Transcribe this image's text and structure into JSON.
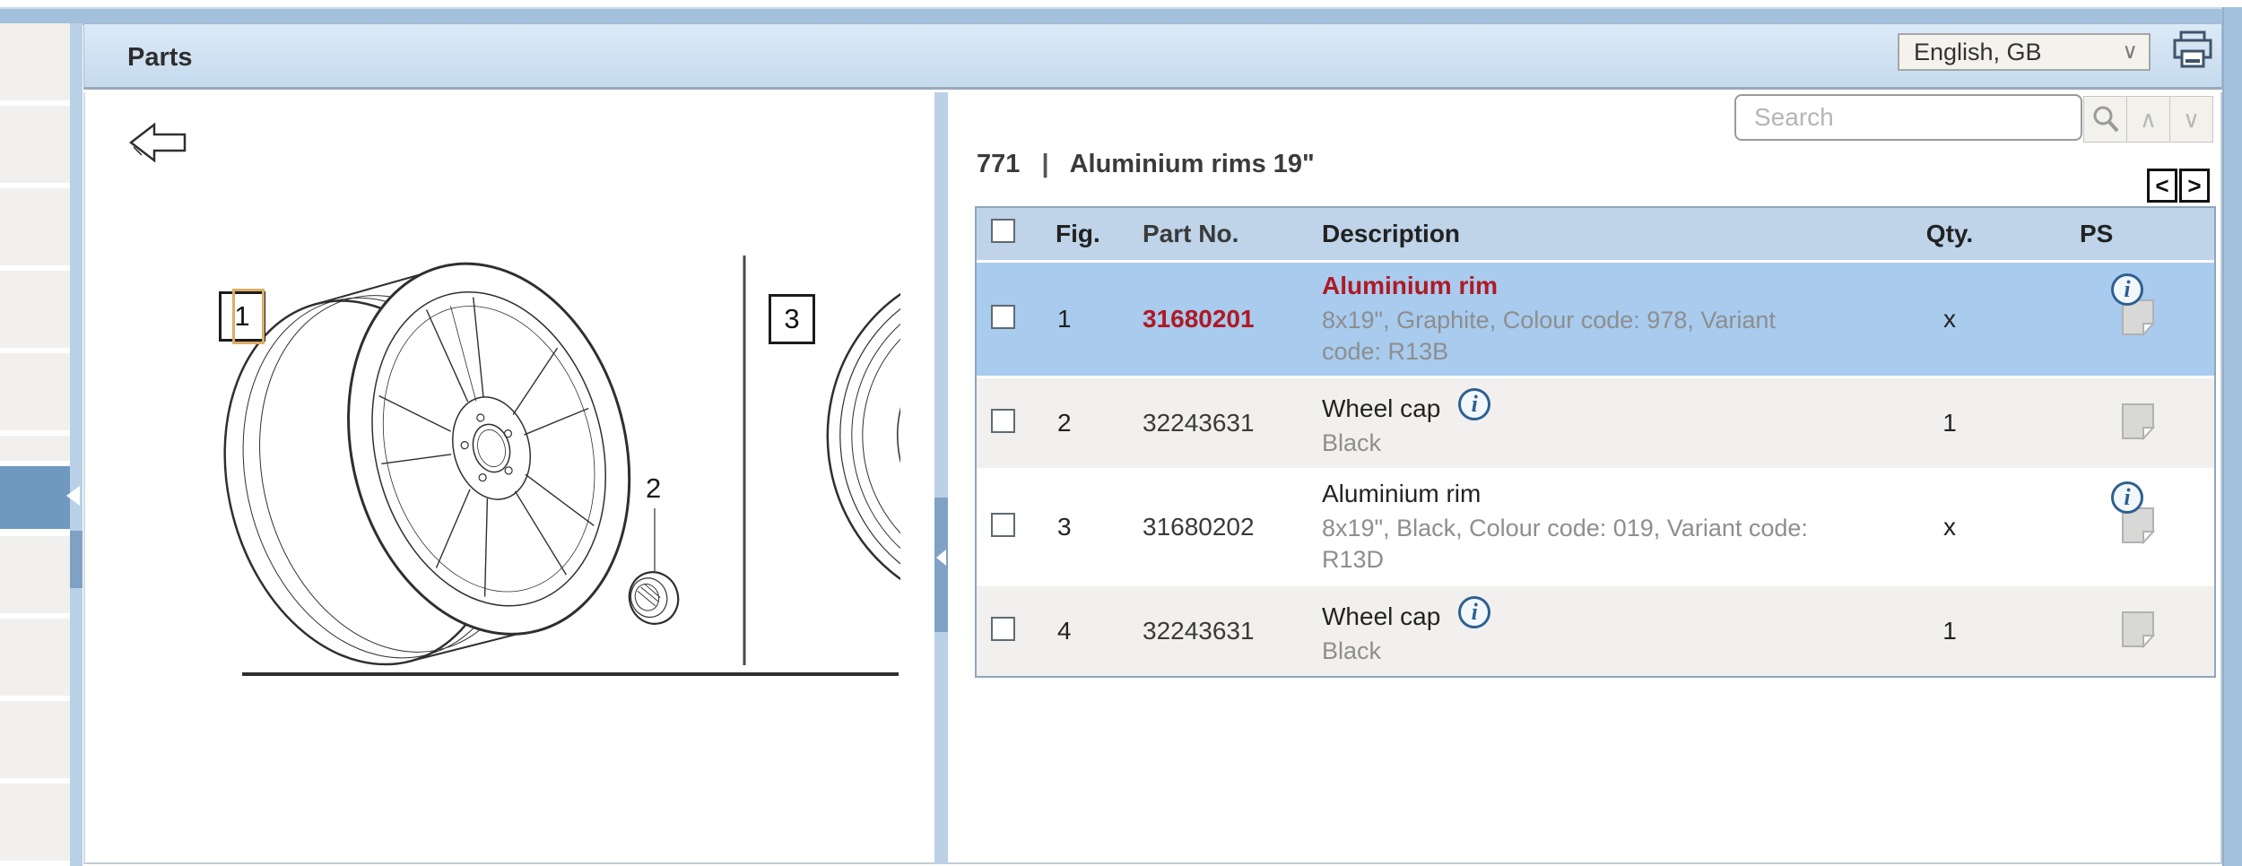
{
  "window": {
    "title": "Parts"
  },
  "toolbar": {
    "language_selector": {
      "value": "English, GB",
      "chevron": "∨"
    },
    "print_icon": "printer-icon"
  },
  "search": {
    "placeholder": "Search",
    "up_glyph": "∧",
    "down_glyph": "∨"
  },
  "section": {
    "number": "771",
    "divider": "|",
    "title": "Aluminium rims 19\""
  },
  "pager": {
    "prev": "<",
    "next": ">"
  },
  "diagram": {
    "callout_1": "1",
    "callout_2": "2",
    "callout_3": "3"
  },
  "table": {
    "headers": {
      "fig": "Fig.",
      "part_no": "Part No.",
      "description": "Description",
      "qty": "Qty.",
      "ps": "PS"
    },
    "rows": [
      {
        "fig": "1",
        "part_no": "31680201",
        "name": "Aluminium rim",
        "detail": "8x19\", Graphite, Colour code: 978, Variant code: R13B",
        "qty": "x",
        "selected": true
      },
      {
        "fig": "2",
        "part_no": "32243631",
        "name": "Wheel cap",
        "detail": "Black",
        "qty": "1",
        "selected": false
      },
      {
        "fig": "3",
        "part_no": "31680202",
        "name": "Aluminium rim",
        "detail": "8x19\", Black, Colour code: 019, Variant code: R13D",
        "qty": "x",
        "selected": false
      },
      {
        "fig": "4",
        "part_no": "32243631",
        "name": "Wheel cap",
        "detail": "Black",
        "qty": "1",
        "selected": false
      }
    ]
  },
  "colors": {
    "frame_blue": "#a3c1dd",
    "panel_header": "#cfe1f2",
    "table_header": "#bfd4e9",
    "selected_row": "#a8cbee",
    "zebra_gray": "#f1f0ee",
    "accent_red": "#b01923",
    "info_icon_blue": "#2e6091",
    "splitter_thumb": "#7fa1c4"
  }
}
